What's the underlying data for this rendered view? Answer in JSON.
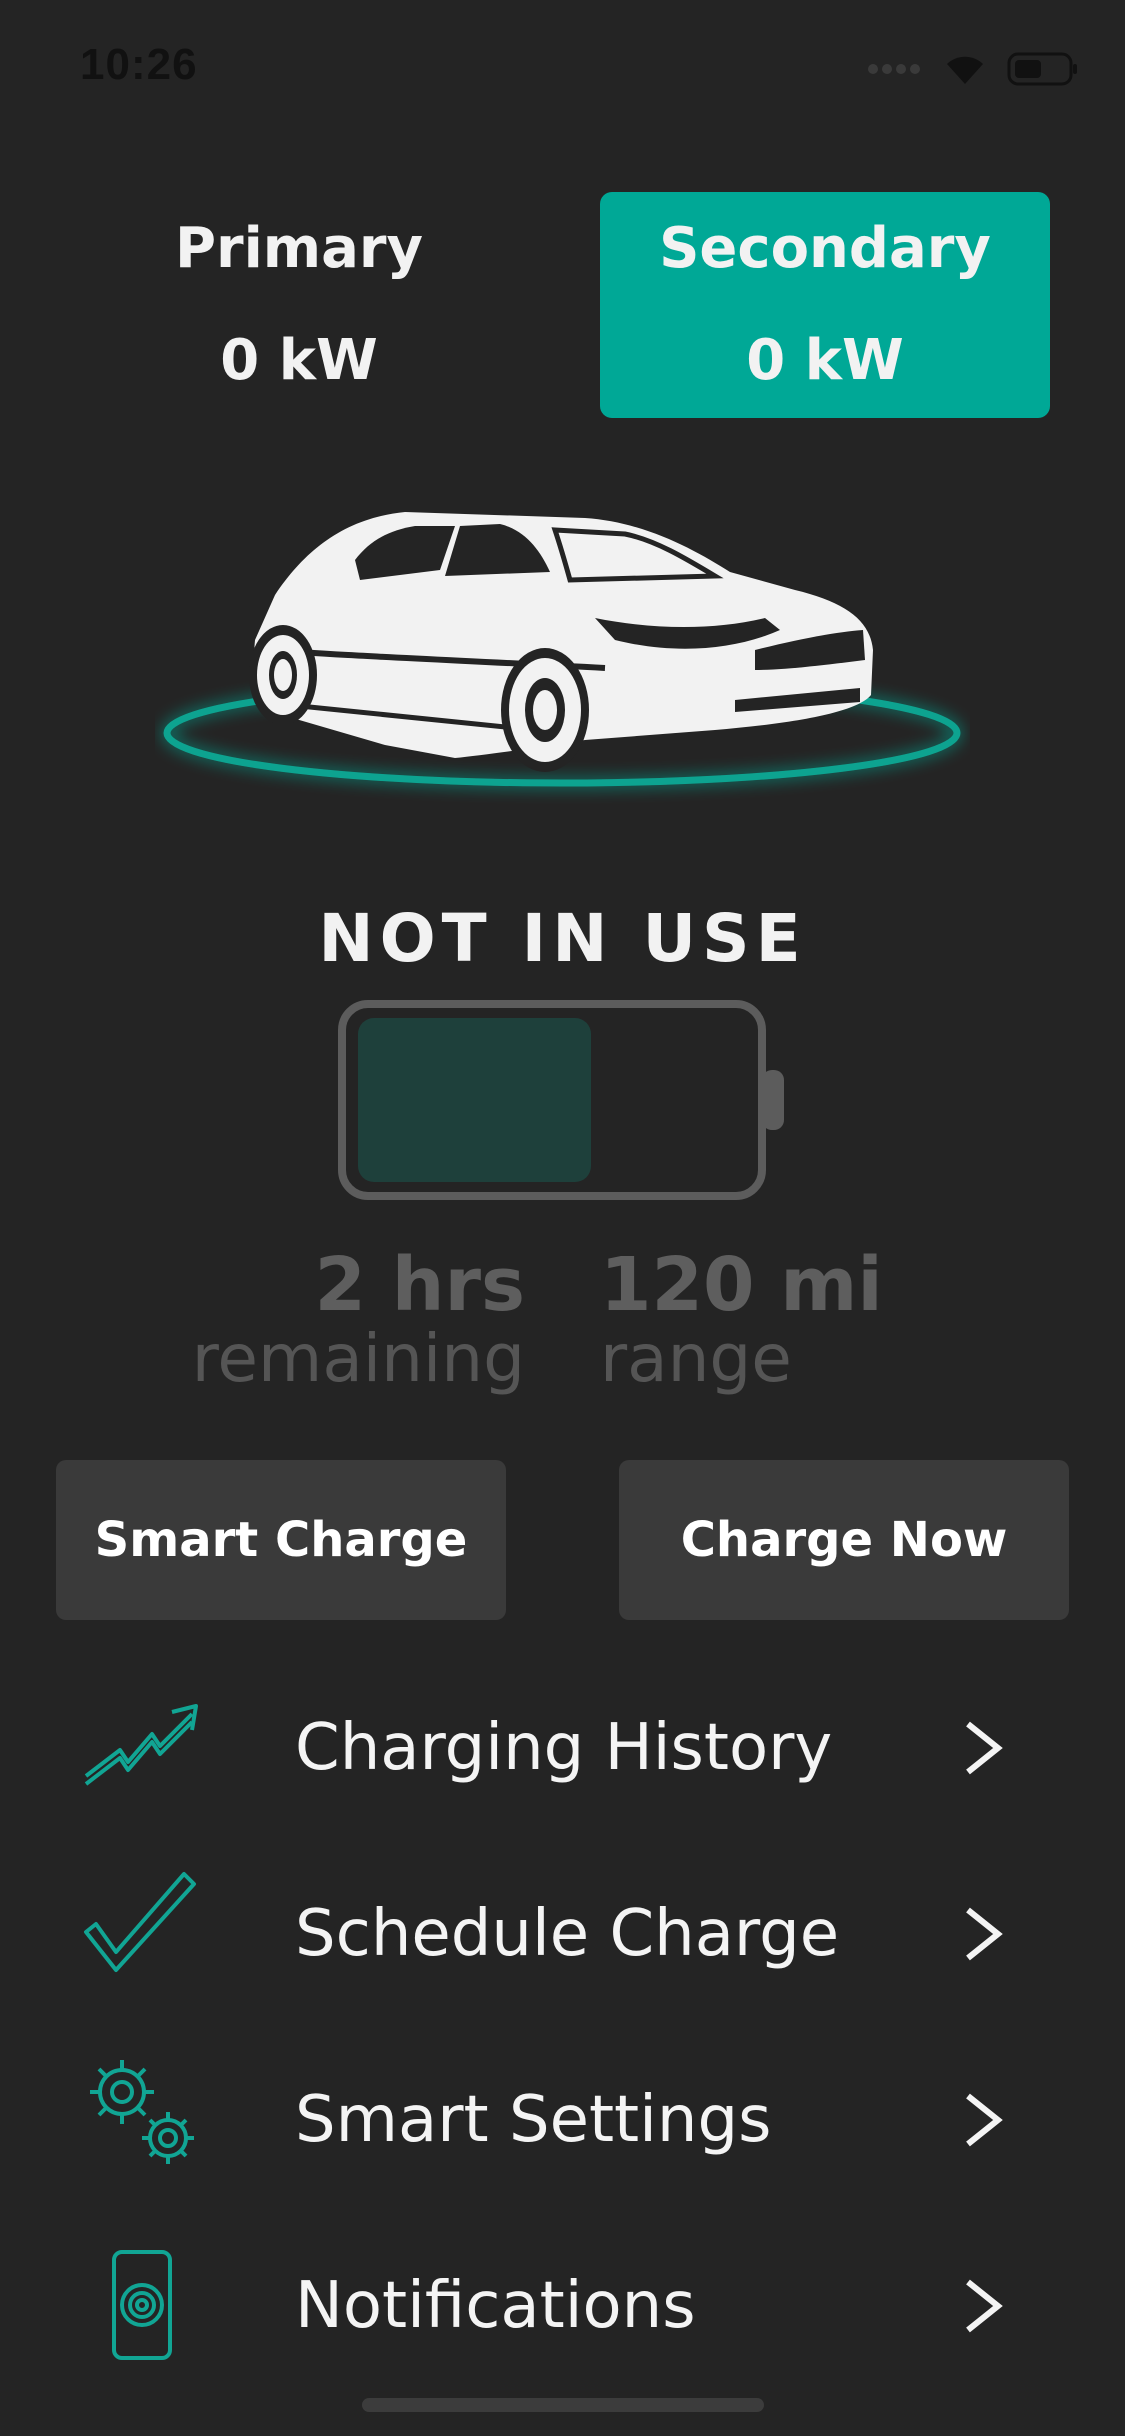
{
  "status_bar": {
    "time": "10:26"
  },
  "outlets": {
    "primary": {
      "name": "Primary",
      "power": "0 kW"
    },
    "secondary": {
      "name": "Secondary",
      "power": "0 kW"
    }
  },
  "charging": {
    "status": "NOT IN USE",
    "battery_level_fraction": 0.6,
    "time_value": "2 hrs",
    "time_label": "remaining",
    "range_value": "120 mi",
    "range_label": "range"
  },
  "actions": {
    "smart_charge": "Smart Charge",
    "charge_now": "Charge Now"
  },
  "menu": [
    {
      "label": "Charging History",
      "icon": "trending-up-icon"
    },
    {
      "label": "Schedule Charge",
      "icon": "checkmark-icon"
    },
    {
      "label": "Smart Settings",
      "icon": "gears-icon"
    },
    {
      "label": "Notifications",
      "icon": "phone-notification-icon"
    }
  ],
  "colors": {
    "background": "#242424",
    "accent": "#00a896",
    "battery_fill": "#1e403b",
    "button": "#3a3a3a"
  }
}
